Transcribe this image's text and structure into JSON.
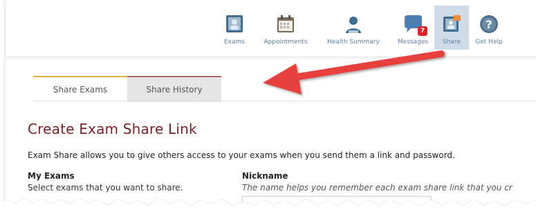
{
  "nav": {
    "items": [
      {
        "label": "Exams",
        "icon": "exams-icon"
      },
      {
        "label": "Appointments",
        "icon": "calendar-icon"
      },
      {
        "label": "Health Summary",
        "icon": "person-icon"
      },
      {
        "label": "Messages",
        "icon": "messages-icon",
        "badge": "7"
      },
      {
        "label": "Share",
        "icon": "share-icon",
        "active": true
      },
      {
        "label": "Get Help",
        "icon": "help-icon"
      }
    ]
  },
  "tabs": [
    {
      "label": "Share Exams",
      "active": true
    },
    {
      "label": "Share History",
      "active": false
    }
  ],
  "page": {
    "title": "Create Exam Share Link",
    "description": "Exam Share allows you to give others access to your exams when you send them a link and password."
  },
  "my_exams": {
    "label": "My Exams",
    "help": "Select exams that you want to share."
  },
  "nickname": {
    "label": "Nickname",
    "help": "The name helps you remember each exam share link that you cr"
  },
  "colors": {
    "accent_title": "#7b1f22",
    "nav_active_bg": "#cfdbe6",
    "annotation_arrow": "#e8403d",
    "badge": "#e21f26"
  }
}
